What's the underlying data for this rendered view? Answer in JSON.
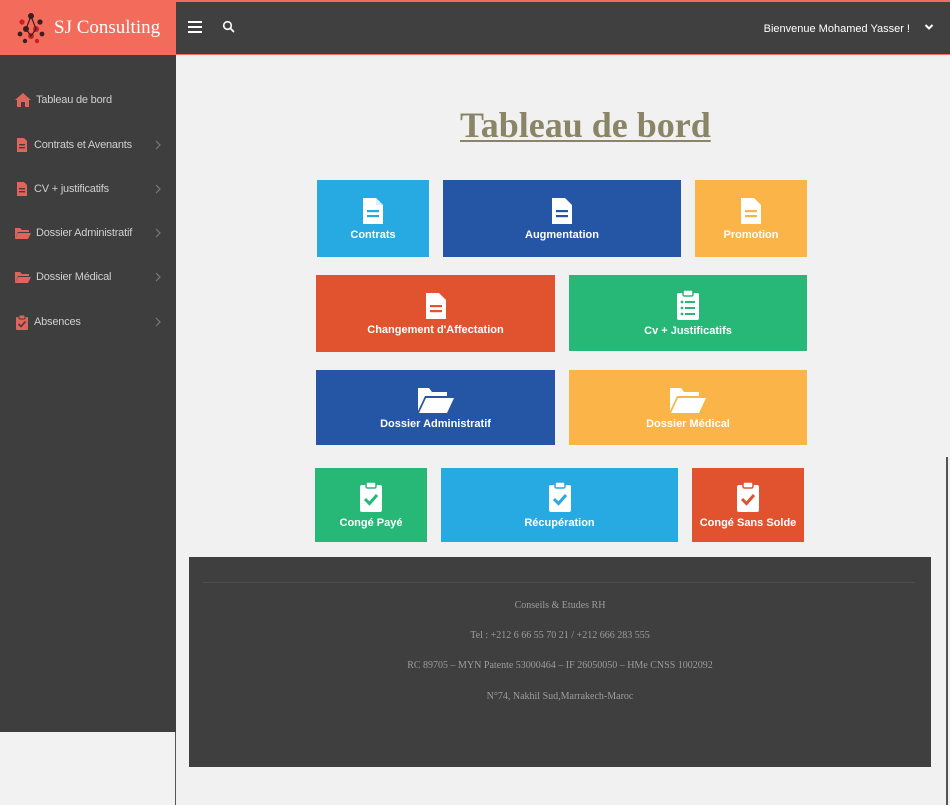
{
  "brand": {
    "name": "SJ Consulting"
  },
  "header": {
    "welcome": "Bienvenue Mohamed Yasser !"
  },
  "sidebar": {
    "items": [
      {
        "label": "Tableau de bord",
        "icon": "home-icon"
      },
      {
        "label": "Contrats et Avenants",
        "icon": "file-icon"
      },
      {
        "label": "CV + justificatifs",
        "icon": "file-icon"
      },
      {
        "label": "Dossier Administratif",
        "icon": "folder-icon"
      },
      {
        "label": "Dossier Médical",
        "icon": "folder-icon"
      },
      {
        "label": "Absences",
        "icon": "clipboard-check-icon"
      }
    ]
  },
  "main": {
    "title": "Tableau de bord",
    "tiles": [
      {
        "label": "Contrats",
        "icon": "file-icon",
        "color": "#27aae1"
      },
      {
        "label": "Augmentation",
        "icon": "file-icon",
        "color": "#2556a5"
      },
      {
        "label": "Promotion",
        "icon": "file-icon",
        "color": "#fbb447"
      },
      {
        "label": "Changement d'Affectation",
        "icon": "file-icon",
        "color": "#e0532e"
      },
      {
        "label": "Cv + Justificatifs",
        "icon": "clipboard-list-icon",
        "color": "#27b776"
      },
      {
        "label": "Dossier Administratif",
        "icon": "folder-open-icon",
        "color": "#2556a5"
      },
      {
        "label": "Dossier Médical",
        "icon": "folder-open-icon",
        "color": "#fbb447"
      },
      {
        "label": "Congé Payé",
        "icon": "clipboard-check-icon",
        "color": "#27b776"
      },
      {
        "label": "Récupération",
        "icon": "clipboard-check-icon",
        "color": "#27aae1"
      },
      {
        "label": "Congé Sans Solde",
        "icon": "clipboard-check-icon",
        "color": "#e0532e"
      }
    ]
  },
  "footer": {
    "line1": "Conseils & Etudes RH",
    "line2": "Tel : +212 6 66 55 70 21 / +212 666 283 555",
    "line3": "RC 89705 – MYN Patente 53000464 – IF 26050050 – HMe CNSS 1002092",
    "line4": "N°74, Nakhil Sud,Marrakech-Maroc"
  },
  "colors": {
    "accent": "#f26b5b",
    "topbar": "#404040",
    "sidebar": "#3e3e3e",
    "title": "#8a8567"
  }
}
